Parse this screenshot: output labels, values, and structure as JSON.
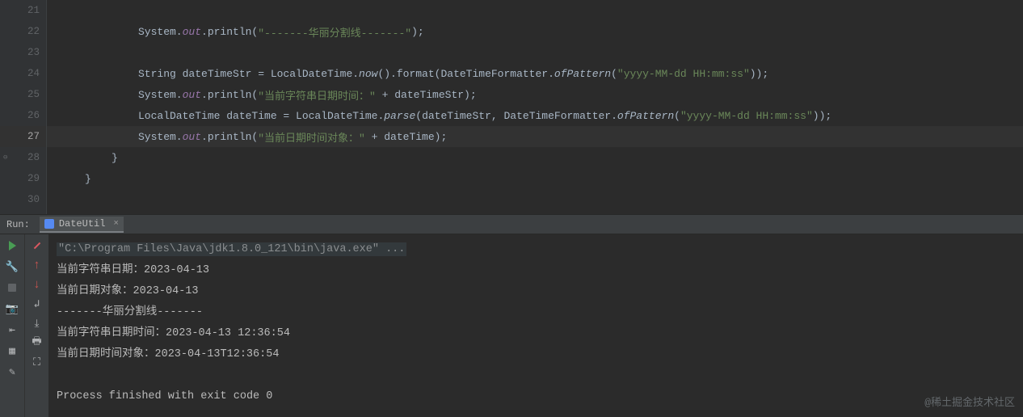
{
  "editor": {
    "lines": [
      {
        "num": 21,
        "guides": [
          0,
          1,
          2
        ],
        "tokens": []
      },
      {
        "num": 22,
        "guides": [
          0,
          1,
          2
        ],
        "tokens": [
          {
            "t": "System.",
            "c": ""
          },
          {
            "t": "out",
            "c": "field"
          },
          {
            "t": ".println(",
            "c": ""
          },
          {
            "t": "\"-------华丽分割线-------\"",
            "c": "str"
          },
          {
            "t": ");",
            "c": ""
          }
        ]
      },
      {
        "num": 23,
        "guides": [
          0,
          1,
          2
        ],
        "tokens": []
      },
      {
        "num": 24,
        "guides": [
          0,
          1,
          2
        ],
        "tokens": [
          {
            "t": "String dateTimeStr = LocalDateTime.",
            "c": ""
          },
          {
            "t": "now",
            "c": "method-it"
          },
          {
            "t": "().format(DateTimeFormatter.",
            "c": ""
          },
          {
            "t": "ofPattern",
            "c": "method-it"
          },
          {
            "t": "(",
            "c": ""
          },
          {
            "t": "\"yyyy-MM-dd HH:mm:ss\"",
            "c": "str"
          },
          {
            "t": "));",
            "c": ""
          }
        ]
      },
      {
        "num": 25,
        "guides": [
          0,
          1,
          2
        ],
        "tokens": [
          {
            "t": "System.",
            "c": ""
          },
          {
            "t": "out",
            "c": "field"
          },
          {
            "t": ".println(",
            "c": ""
          },
          {
            "t": "\"当前字符串日期时间：\"",
            "c": "str"
          },
          {
            "t": " + dateTimeStr);",
            "c": ""
          }
        ]
      },
      {
        "num": 26,
        "guides": [
          0,
          1,
          2
        ],
        "tokens": [
          {
            "t": "LocalDateTime dateTime = LocalDateTime.",
            "c": ""
          },
          {
            "t": "parse",
            "c": "method-it"
          },
          {
            "t": "(dateTimeStr, DateTimeFormatter.",
            "c": ""
          },
          {
            "t": "ofPattern",
            "c": "method-it"
          },
          {
            "t": "(",
            "c": ""
          },
          {
            "t": "\"yyyy-MM-dd HH:mm:ss\"",
            "c": "str"
          },
          {
            "t": "));",
            "c": ""
          }
        ]
      },
      {
        "num": 27,
        "guides": [
          0,
          1,
          2
        ],
        "highlight": true,
        "tokens": [
          {
            "t": "System.",
            "c": ""
          },
          {
            "t": "out",
            "c": "field"
          },
          {
            "t": ".println(",
            "c": ""
          },
          {
            "t": "\"当前日期时间对象：\"",
            "c": "str"
          },
          {
            "t": " + dateTime);",
            "c": ""
          }
        ]
      },
      {
        "num": 28,
        "guides": [
          0,
          1
        ],
        "mark": "⊖",
        "tokens": [
          {
            "t": "}",
            "c": ""
          }
        ],
        "dedent": 1
      },
      {
        "num": 29,
        "guides": [
          0
        ],
        "tokens": [
          {
            "t": "}",
            "c": ""
          }
        ],
        "dedent": 2
      },
      {
        "num": 30,
        "guides": [],
        "tokens": []
      }
    ],
    "indentWidth": 33
  },
  "runbar": {
    "label": "Run:",
    "tabName": "DateUtil",
    "close": "×"
  },
  "console": {
    "first": "\"C:\\Program Files\\Java\\jdk1.8.0_121\\bin\\java.exe\" ...",
    "lines": [
      "当前字符串日期：2023-04-13",
      "当前日期对象：2023-04-13",
      "-------华丽分割线-------",
      "当前字符串日期时间：2023-04-13 12:36:54",
      "当前日期时间对象：2023-04-13T12:36:54",
      "",
      "Process finished with exit code 0"
    ]
  },
  "watermark": "@稀土掘金技术社区"
}
